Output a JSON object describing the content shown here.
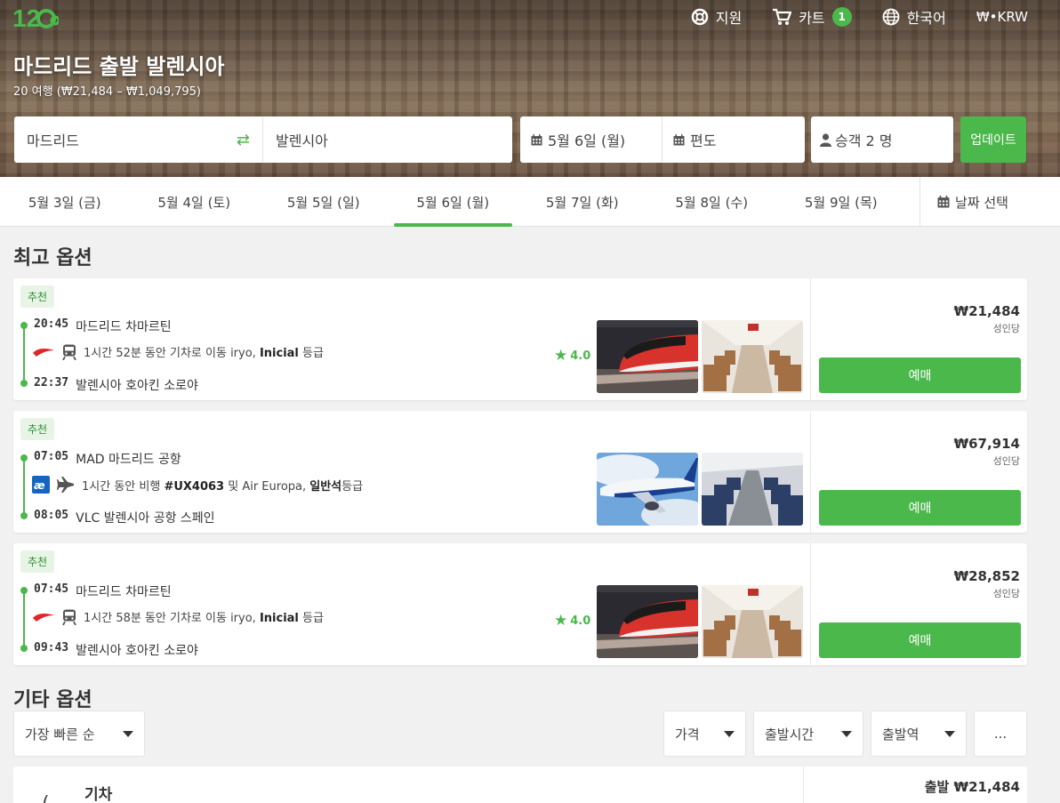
{
  "brand": {
    "logo_text": "12Go",
    "accent": "#4bb84c"
  },
  "nav": {
    "support": "지원",
    "cart": "카트",
    "cart_count": "1",
    "language": "한국어",
    "currency": "₩•KRW"
  },
  "hero": {
    "title": "마드리드 출발 발렌시아",
    "subtitle": "20 여행 (₩21,484 – ₩1,049,795)"
  },
  "search": {
    "from": "마드리드",
    "to": "발렌시아",
    "date": "5월 6일 (월)",
    "return": "편도",
    "passengers": "승객 2 명",
    "update": "업데이트"
  },
  "dates": {
    "tabs": [
      "5월 3일 (금)",
      "5월 4일 (토)",
      "5월 5일 (일)",
      "5월 6일 (월)",
      "5월 7일 (화)",
      "5월 8일 (수)",
      "5월 9일 (목)"
    ],
    "active_index": 3,
    "pick": "날짜 선택"
  },
  "best": {
    "title": "최고 옵션",
    "cards": [
      {
        "badge": "추천",
        "dep_time": "20:45",
        "dep_place": "마드리드 차마르틴",
        "desc_pre": "1시간 52분 동안 기차로 이동 iryo, ",
        "desc_bold": "Inicial",
        "desc_post": " 등급",
        "arr_time": "22:37",
        "arr_place": "발렌시아 호아킨 소로야",
        "rating": "4.0",
        "price": "₩21,484",
        "per": "성인당",
        "book": "예매",
        "mode": "train"
      },
      {
        "badge": "추천",
        "dep_time": "07:05",
        "dep_place": "MAD 마드리드 공항",
        "desc_pre": "1시간 동안 비행 ",
        "desc_bold": "#UX4063",
        "desc_mid": " 및 Air Europa, ",
        "desc_bold2": "일반석",
        "desc_post": "등급",
        "arr_time": "08:05",
        "arr_place": "VLC 발렌시아 공항 스페인",
        "rating": "",
        "price": "₩67,914",
        "per": "성인당",
        "book": "예매",
        "mode": "flight"
      },
      {
        "badge": "추천",
        "dep_time": "07:45",
        "dep_place": "마드리드 차마르틴",
        "desc_pre": "1시간 58분 동안 기차로 이동 iryo, ",
        "desc_bold": "Inicial",
        "desc_post": " 등급",
        "arr_time": "09:43",
        "arr_place": "발렌시아 호아킨 소로야",
        "rating": "4.0",
        "price": "₩28,852",
        "per": "성인당",
        "book": "예매",
        "mode": "train"
      }
    ]
  },
  "other": {
    "title": "기타 옵션",
    "sort": "가장 빠른 순",
    "filters": [
      "가격",
      "출발시간",
      "출발역",
      "..."
    ],
    "first_row": {
      "label": "기차",
      "price": "출발 ₩21,484"
    }
  }
}
